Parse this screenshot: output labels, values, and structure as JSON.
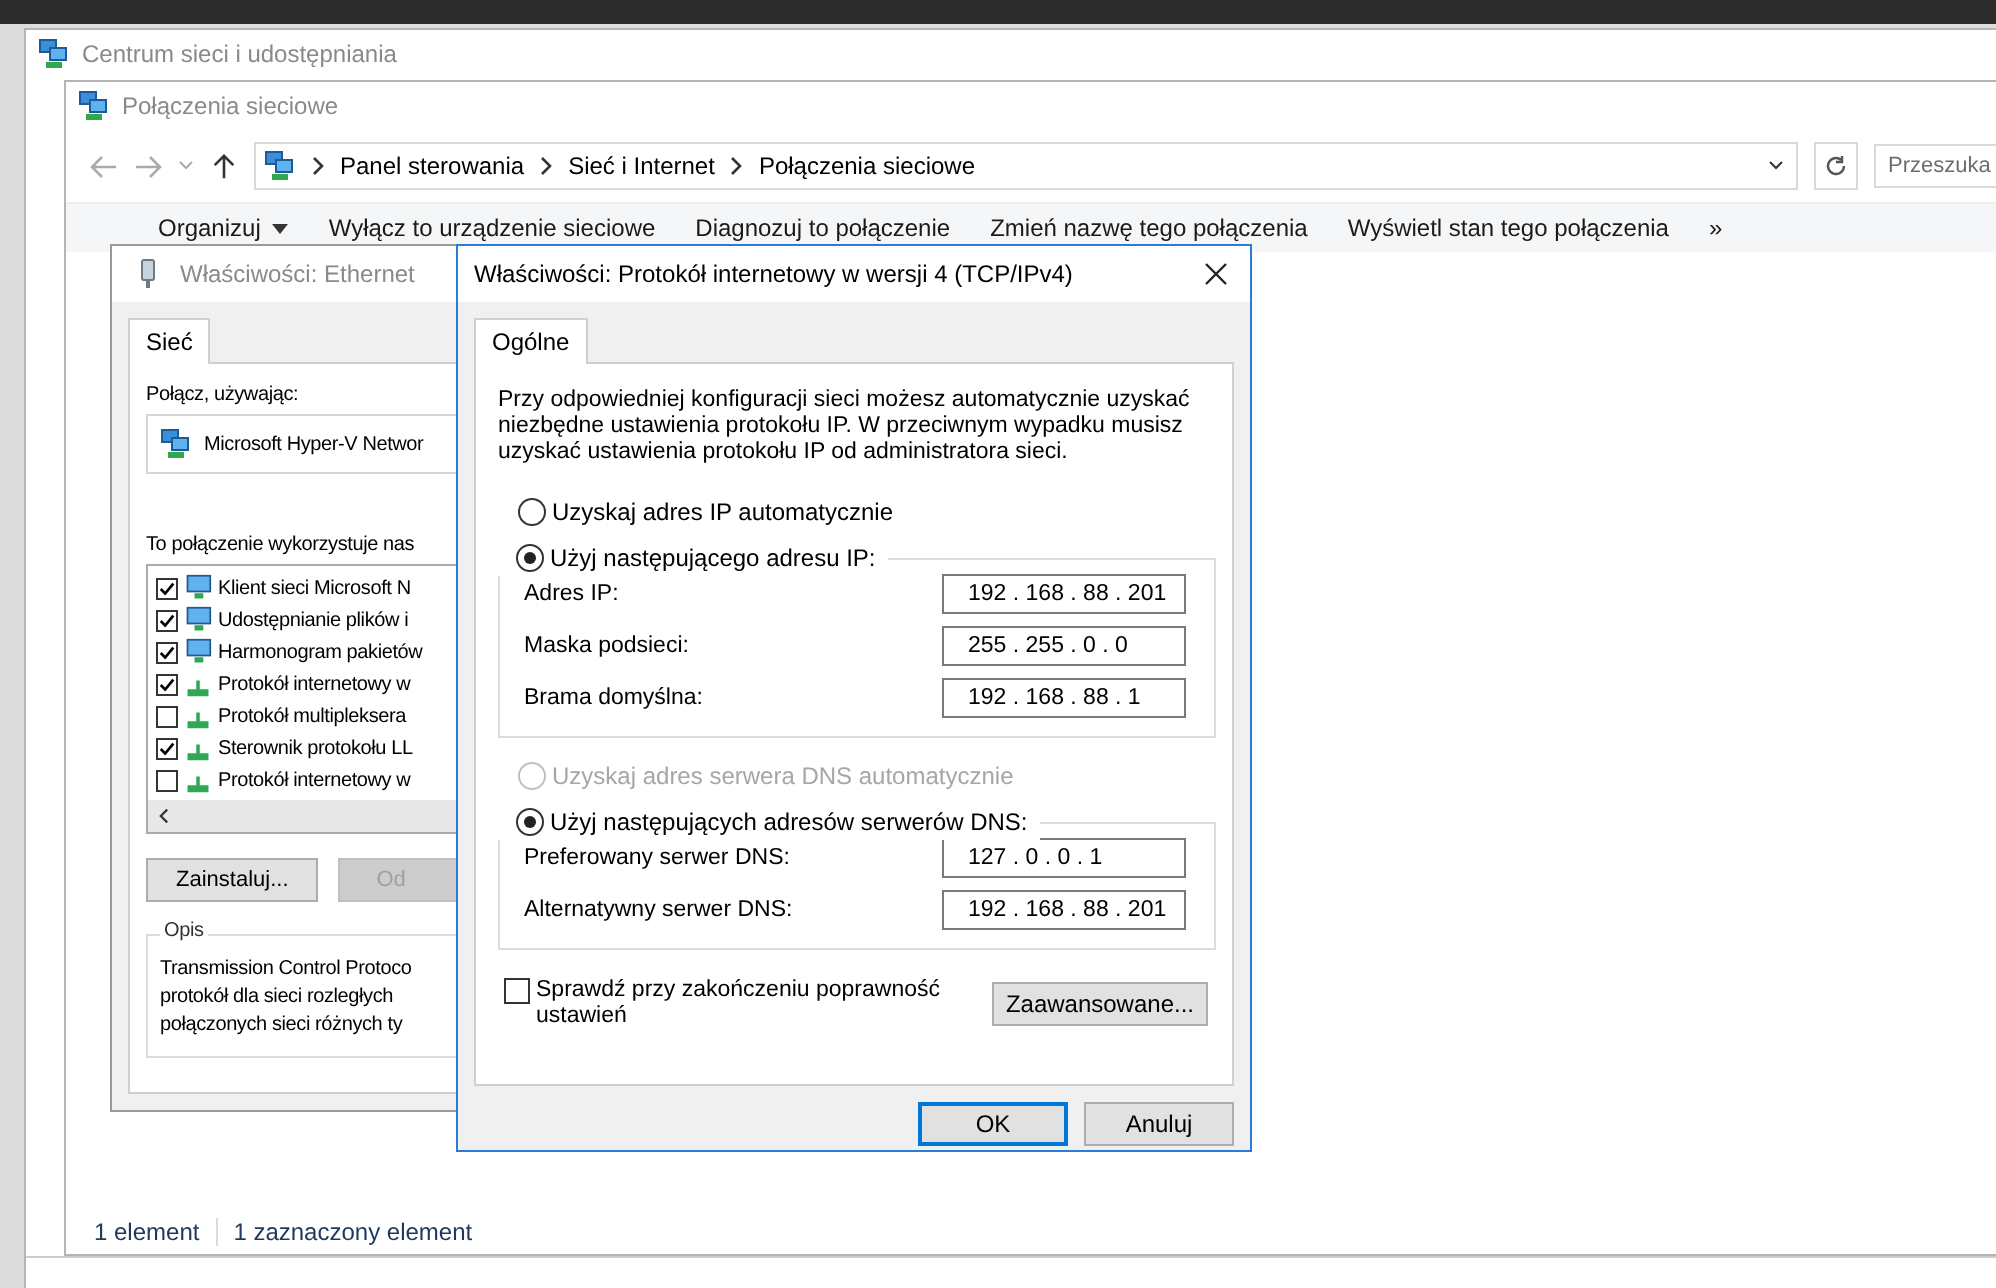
{
  "back_window": {
    "title": "Centrum sieci i udostępniania"
  },
  "explorer": {
    "title": "Połączenia sieciowe",
    "breadcrumb": [
      "Panel sterowania",
      "Sieć i Internet",
      "Połączenia sieciowe"
    ],
    "search": {
      "placeholder": "Przeszuka"
    },
    "toolbar": [
      {
        "label": "Organizuj",
        "kind": "menu"
      },
      {
        "label": "Wyłącz to urządzenie sieciowe",
        "kind": "command"
      },
      {
        "label": "Diagnozuj to połączenie",
        "kind": "command"
      },
      {
        "label": "Zmień nazwę tego połączenia",
        "kind": "command"
      },
      {
        "label": "Wyświetl stan tego połączenia",
        "kind": "command"
      }
    ],
    "toolbar_overflow": "»",
    "status_bar": [
      "1 element",
      "1 zaznaczony element"
    ]
  },
  "ethernet_dialog": {
    "title": "Właściwości: Ethernet",
    "tabs": [
      {
        "label": "Sieć",
        "selected": true
      }
    ],
    "connect_using_label": "Połącz, używając:",
    "adapter": "Microsoft Hyper-V Networ",
    "components_label": "To połączenie wykorzystuje nas",
    "components": [
      {
        "label": "Klient sieci Microsoft N",
        "checked": true,
        "kind": "service"
      },
      {
        "label": "Udostępnianie plików i",
        "checked": true,
        "kind": "service"
      },
      {
        "label": "Harmonogram pakietów",
        "checked": true,
        "kind": "service"
      },
      {
        "label": "Protokół internetowy w",
        "checked": true,
        "kind": "protocol"
      },
      {
        "label": "Protokół multipleksera",
        "checked": false,
        "kind": "protocol"
      },
      {
        "label": "Sterownik protokołu LL",
        "checked": true,
        "kind": "protocol"
      },
      {
        "label": "Protokół internetowy w",
        "checked": false,
        "kind": "protocol"
      }
    ],
    "buttons": [
      {
        "label": "Zainstaluj...",
        "disabled": false
      },
      {
        "label": "Od",
        "disabled": true
      }
    ],
    "description": {
      "title": "Opis",
      "lines": [
        "Transmission Control Protoco",
        "protokół dla sieci rozległych",
        "połączonych sieci różnych ty"
      ]
    }
  },
  "tcp_dialog": {
    "title": "Właściwości: Protokół internetowy w wersji 4 (TCP/IPv4)",
    "tabs": [
      {
        "label": "Ogólne",
        "selected": true
      }
    ],
    "intro": "Przy odpowiedniej konfiguracji sieci możesz automatycznie uzyskać niezbędne ustawienia protokołu IP. W przeciwnym wypadku musisz uzyskać ustawienia protokołu IP od administratora sieci.",
    "ip_options": [
      {
        "label": "Uzyskaj adres IP automatycznie",
        "selected": false,
        "disabled": false
      },
      {
        "label": "Użyj następującego adresu IP:",
        "selected": true,
        "disabled": false
      }
    ],
    "ip_fields": [
      {
        "label": "Adres IP:",
        "value": "192 . 168 . 88 . 201"
      },
      {
        "label": "Maska podsieci:",
        "value": "255 . 255 . 0 . 0"
      },
      {
        "label": "Brama domyślna:",
        "value": "192 . 168 . 88 . 1"
      }
    ],
    "dns_options": [
      {
        "label": "Uzyskaj adres serwera DNS automatycznie",
        "selected": false,
        "disabled": true
      },
      {
        "label": "Użyj następujących adresów serwerów DNS:",
        "selected": true,
        "disabled": false
      }
    ],
    "dns_fields": [
      {
        "label": "Preferowany serwer DNS:",
        "value": "127 . 0 . 0 . 1"
      },
      {
        "label": "Alternatywny serwer DNS:",
        "value": "192 . 168 . 88 . 201"
      }
    ],
    "validate": {
      "label": "Sprawdź przy zakończeniu poprawność ustawień",
      "checked": false
    },
    "advanced_button": "Zaawansowane...",
    "buttons": [
      {
        "label": "OK",
        "default": true
      },
      {
        "label": "Anuluj",
        "default": false
      }
    ]
  }
}
